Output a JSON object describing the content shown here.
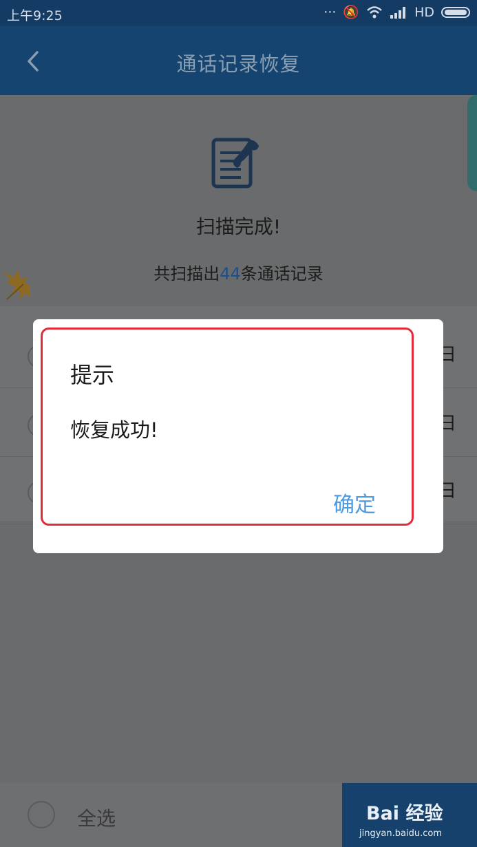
{
  "status_bar": {
    "time": "上午9:25",
    "network": "HD"
  },
  "app_bar": {
    "title": "通话记录恢复"
  },
  "scan": {
    "title": "扫描完成!",
    "count_prefix": "共扫描出",
    "count": "44",
    "count_suffix": "条通话记录"
  },
  "list": {
    "rows": [
      {
        "date_fragment": "日"
      },
      {
        "date_fragment": "日"
      },
      {
        "date_fragment": "日"
      }
    ]
  },
  "bottom": {
    "select_all": "全选"
  },
  "dialog": {
    "title": "提示",
    "message": "恢复成功!",
    "ok": "确定"
  },
  "watermark": {
    "brand": "Bai 经验",
    "url": "jingyan.baidu.com"
  },
  "colors": {
    "primary": "#14446f",
    "link": "#4a9be2",
    "highlight": "#e02b38"
  }
}
